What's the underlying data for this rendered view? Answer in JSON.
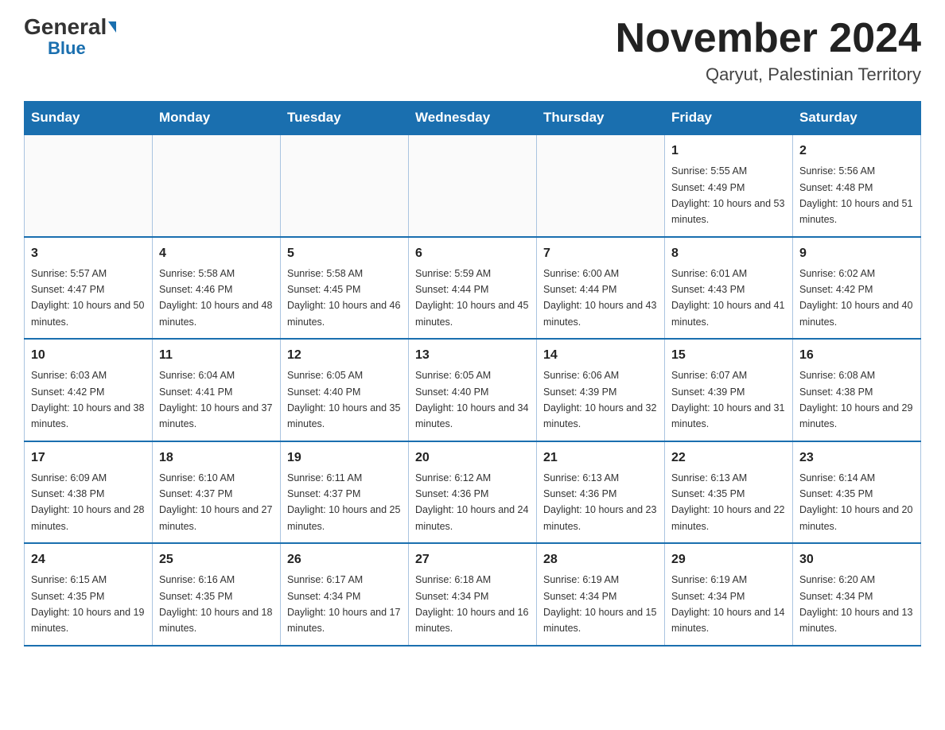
{
  "header": {
    "logo_general": "General",
    "logo_blue": "Blue",
    "month_title": "November 2024",
    "location": "Qaryut, Palestinian Territory"
  },
  "days_of_week": [
    "Sunday",
    "Monday",
    "Tuesday",
    "Wednesday",
    "Thursday",
    "Friday",
    "Saturday"
  ],
  "weeks": [
    [
      {
        "day": "",
        "info": ""
      },
      {
        "day": "",
        "info": ""
      },
      {
        "day": "",
        "info": ""
      },
      {
        "day": "",
        "info": ""
      },
      {
        "day": "",
        "info": ""
      },
      {
        "day": "1",
        "info": "Sunrise: 5:55 AM\nSunset: 4:49 PM\nDaylight: 10 hours and 53 minutes."
      },
      {
        "day": "2",
        "info": "Sunrise: 5:56 AM\nSunset: 4:48 PM\nDaylight: 10 hours and 51 minutes."
      }
    ],
    [
      {
        "day": "3",
        "info": "Sunrise: 5:57 AM\nSunset: 4:47 PM\nDaylight: 10 hours and 50 minutes."
      },
      {
        "day": "4",
        "info": "Sunrise: 5:58 AM\nSunset: 4:46 PM\nDaylight: 10 hours and 48 minutes."
      },
      {
        "day": "5",
        "info": "Sunrise: 5:58 AM\nSunset: 4:45 PM\nDaylight: 10 hours and 46 minutes."
      },
      {
        "day": "6",
        "info": "Sunrise: 5:59 AM\nSunset: 4:44 PM\nDaylight: 10 hours and 45 minutes."
      },
      {
        "day": "7",
        "info": "Sunrise: 6:00 AM\nSunset: 4:44 PM\nDaylight: 10 hours and 43 minutes."
      },
      {
        "day": "8",
        "info": "Sunrise: 6:01 AM\nSunset: 4:43 PM\nDaylight: 10 hours and 41 minutes."
      },
      {
        "day": "9",
        "info": "Sunrise: 6:02 AM\nSunset: 4:42 PM\nDaylight: 10 hours and 40 minutes."
      }
    ],
    [
      {
        "day": "10",
        "info": "Sunrise: 6:03 AM\nSunset: 4:42 PM\nDaylight: 10 hours and 38 minutes."
      },
      {
        "day": "11",
        "info": "Sunrise: 6:04 AM\nSunset: 4:41 PM\nDaylight: 10 hours and 37 minutes."
      },
      {
        "day": "12",
        "info": "Sunrise: 6:05 AM\nSunset: 4:40 PM\nDaylight: 10 hours and 35 minutes."
      },
      {
        "day": "13",
        "info": "Sunrise: 6:05 AM\nSunset: 4:40 PM\nDaylight: 10 hours and 34 minutes."
      },
      {
        "day": "14",
        "info": "Sunrise: 6:06 AM\nSunset: 4:39 PM\nDaylight: 10 hours and 32 minutes."
      },
      {
        "day": "15",
        "info": "Sunrise: 6:07 AM\nSunset: 4:39 PM\nDaylight: 10 hours and 31 minutes."
      },
      {
        "day": "16",
        "info": "Sunrise: 6:08 AM\nSunset: 4:38 PM\nDaylight: 10 hours and 29 minutes."
      }
    ],
    [
      {
        "day": "17",
        "info": "Sunrise: 6:09 AM\nSunset: 4:38 PM\nDaylight: 10 hours and 28 minutes."
      },
      {
        "day": "18",
        "info": "Sunrise: 6:10 AM\nSunset: 4:37 PM\nDaylight: 10 hours and 27 minutes."
      },
      {
        "day": "19",
        "info": "Sunrise: 6:11 AM\nSunset: 4:37 PM\nDaylight: 10 hours and 25 minutes."
      },
      {
        "day": "20",
        "info": "Sunrise: 6:12 AM\nSunset: 4:36 PM\nDaylight: 10 hours and 24 minutes."
      },
      {
        "day": "21",
        "info": "Sunrise: 6:13 AM\nSunset: 4:36 PM\nDaylight: 10 hours and 23 minutes."
      },
      {
        "day": "22",
        "info": "Sunrise: 6:13 AM\nSunset: 4:35 PM\nDaylight: 10 hours and 22 minutes."
      },
      {
        "day": "23",
        "info": "Sunrise: 6:14 AM\nSunset: 4:35 PM\nDaylight: 10 hours and 20 minutes."
      }
    ],
    [
      {
        "day": "24",
        "info": "Sunrise: 6:15 AM\nSunset: 4:35 PM\nDaylight: 10 hours and 19 minutes."
      },
      {
        "day": "25",
        "info": "Sunrise: 6:16 AM\nSunset: 4:35 PM\nDaylight: 10 hours and 18 minutes."
      },
      {
        "day": "26",
        "info": "Sunrise: 6:17 AM\nSunset: 4:34 PM\nDaylight: 10 hours and 17 minutes."
      },
      {
        "day": "27",
        "info": "Sunrise: 6:18 AM\nSunset: 4:34 PM\nDaylight: 10 hours and 16 minutes."
      },
      {
        "day": "28",
        "info": "Sunrise: 6:19 AM\nSunset: 4:34 PM\nDaylight: 10 hours and 15 minutes."
      },
      {
        "day": "29",
        "info": "Sunrise: 6:19 AM\nSunset: 4:34 PM\nDaylight: 10 hours and 14 minutes."
      },
      {
        "day": "30",
        "info": "Sunrise: 6:20 AM\nSunset: 4:34 PM\nDaylight: 10 hours and 13 minutes."
      }
    ]
  ]
}
